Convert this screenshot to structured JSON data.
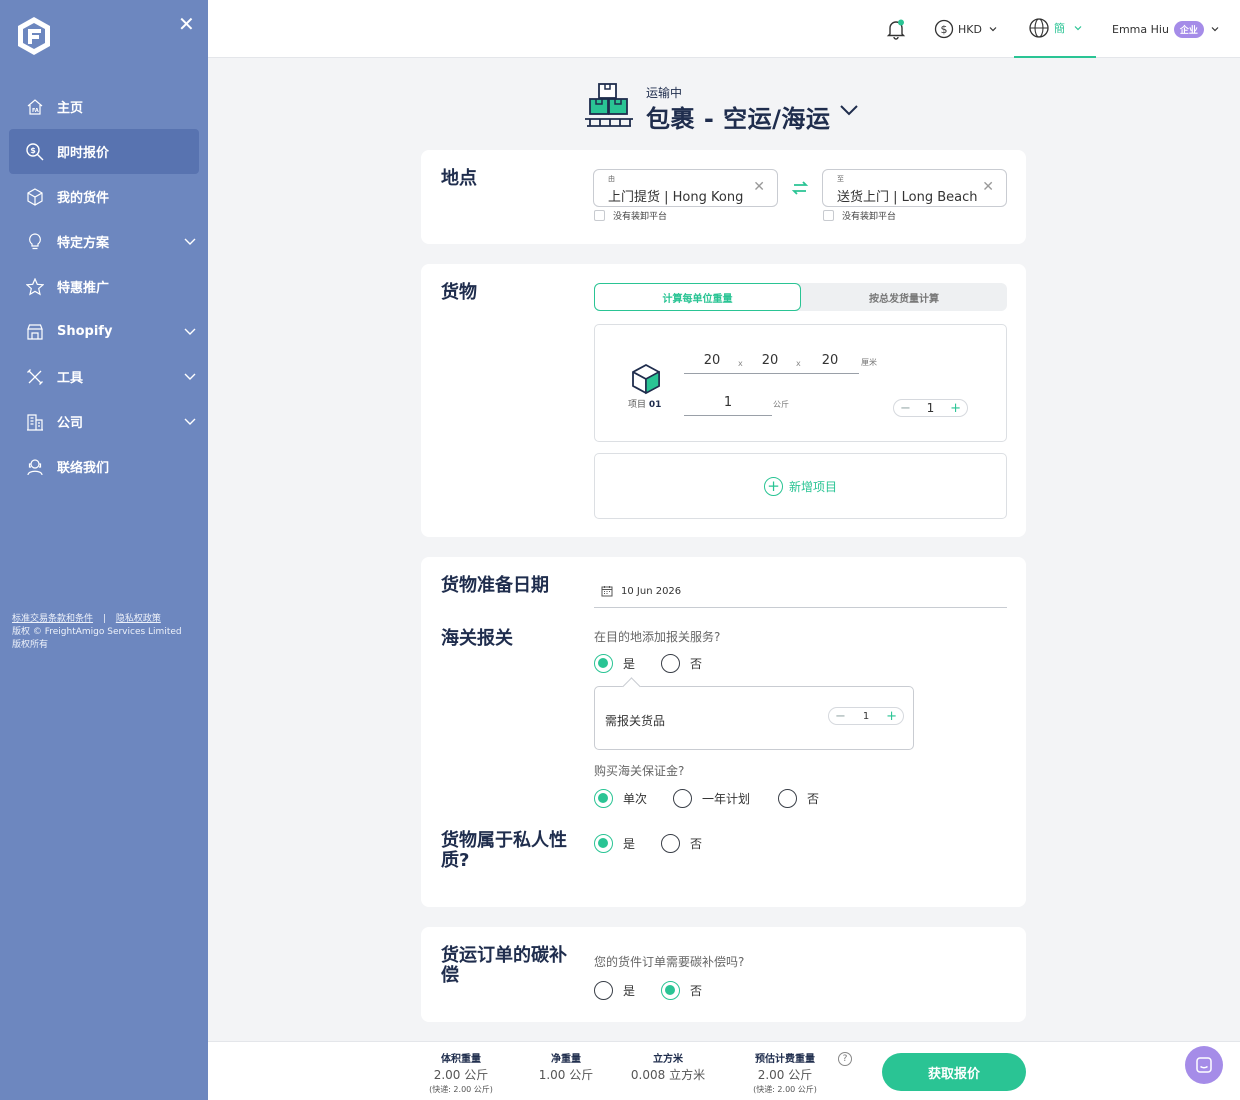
{
  "sidebar": {
    "items": [
      {
        "label": "主页",
        "icon": "home-icon"
      },
      {
        "label": "即时报价",
        "icon": "quote-search-icon"
      },
      {
        "label": "我的货件",
        "icon": "box-icon"
      },
      {
        "label": "特定方案",
        "icon": "lightbulb-icon"
      },
      {
        "label": "特惠推广",
        "icon": "star-icon"
      },
      {
        "label": "Shopify",
        "icon": "store-icon"
      },
      {
        "label": "工具",
        "icon": "tools-icon"
      },
      {
        "label": "公司",
        "icon": "building-icon"
      },
      {
        "label": "联络我们",
        "icon": "support-icon"
      }
    ],
    "legal": {
      "terms": "标准交易条款和条件",
      "separator": "|",
      "privacy": "隐私权政策",
      "copyright": "版权 © FreightAmigo Services Limited",
      "rights": "版权所有"
    }
  },
  "topbar": {
    "currency": "HKD",
    "language": "簡",
    "user_name": "Emma Hiu",
    "user_badge": "企业"
  },
  "header": {
    "status": "运输中",
    "title": "包裹 - 空运/海运"
  },
  "location": {
    "title": "地点",
    "from_label": "由",
    "from_value": "上门提货 | Hong Kong",
    "to_label": "至",
    "to_value": "送货上门 | Long Beach",
    "no_dock": "没有装卸平台"
  },
  "cargo": {
    "title": "货物",
    "tab_unit": "计算每单位重量",
    "tab_total": "按总发货量计算",
    "item": {
      "label_prefix": "项目",
      "label_number": "01",
      "length": "20",
      "width": "20",
      "height": "20",
      "times": "x",
      "dim_unit": "厘米",
      "weight": "1",
      "weight_unit": "公斤",
      "qty_minus": "−",
      "quantity": "1",
      "qty_plus": "+"
    },
    "add_item": "新增项目"
  },
  "details": {
    "date_title": "货物准备日期",
    "date_value": "10 Jun 2026",
    "customs_title": "海关报关",
    "customs_question": "在目的地添加报关服务?",
    "yes": "是",
    "no": "否",
    "customs_goods_label": "需报关货品",
    "customs_goods_qty": "1",
    "bond_question": "购买海关保证金?",
    "bond_single": "单次",
    "bond_annual": "一年计划",
    "private_title": "货物属于私人性质?"
  },
  "carbon": {
    "title": "货运订单的碳补偿",
    "question": "您的货件订单需要碳补偿吗?",
    "yes": "是",
    "no": "否"
  },
  "summary": {
    "vol_label": "体积重量",
    "vol_value": "2.00 公斤",
    "vol_sub": "(快递:  2.00 公斤)",
    "net_label": "净重量",
    "net_value": "1.00 公斤",
    "cbm_label": "立方米",
    "cbm_value": "0.008 立方米",
    "chargeable_label": "预估计费重量",
    "chargeable_value": "2.00 公斤",
    "chargeable_sub": "(快递:  2.00 公斤)",
    "help": "?",
    "quote_button": "获取报价"
  },
  "colors": {
    "sidebar": "#6d87bf",
    "sidebar_active": "#5873b0",
    "accent": "#2ac494",
    "badge": "#a58ce8",
    "navy": "#1f2d4d"
  }
}
